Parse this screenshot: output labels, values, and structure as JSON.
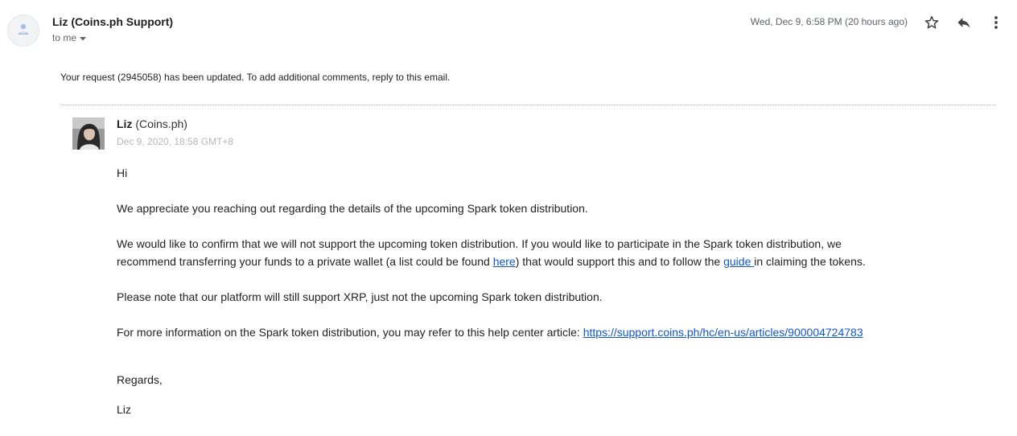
{
  "header": {
    "sender": "Liz (Coins.ph Support)",
    "recipient": "to me",
    "date": "Wed, Dec 9, 6:58 PM (20 hours ago)",
    "icons": [
      "person-icon",
      "star-icon",
      "reply-icon",
      "more-vert-icon",
      "chevron-down-icon"
    ]
  },
  "notice": "Your request (2945058) has been updated. To add additional comments, reply to this email.",
  "message": {
    "author_name": "Liz",
    "author_org": "(Coins.ph)",
    "author_date": "Dec 9, 2020, 18:58 GMT+8",
    "greeting": "Hi",
    "p1": "We appreciate you reaching out regarding the details of the upcoming Spark token distribution.",
    "p2_line1": "We would like to confirm that we will not support the upcoming token distribution. If you would like to participate in the Spark token distribution, we",
    "p2_line2_a": "recommend transferring your funds to a private wallet (a list could be found ",
    "p2_link_here": "here",
    "p2_line2_b": ") that would support this and to follow the ",
    "p2_link_guide": "guide ",
    "p2_line2_c": "in claiming the tokens.",
    "p3": "Please note that our platform will still support XRP, just not the upcoming Spark token distribution.",
    "p4_text": "For more information on the Spark token distribution, you may refer to this help center article: ",
    "p4_link": "https://support.coins.ph/hc/en-us/articles/900004724783",
    "regards": "Regards,",
    "signature": "Liz"
  },
  "colors": {
    "link": "#1155cc",
    "muted": "#5f6368",
    "faint": "#b7b7b7"
  }
}
